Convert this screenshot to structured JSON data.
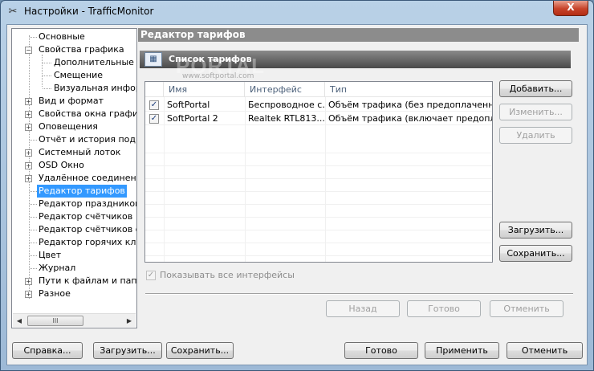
{
  "window": {
    "title": "Настройки - TrafficMonitor",
    "close_label": "X"
  },
  "tree": {
    "items": [
      {
        "label": "Основные",
        "expander": ""
      },
      {
        "label": "Свойства графика",
        "expander": "−"
      },
      {
        "label": "Дополнительные на",
        "expander": ""
      },
      {
        "label": "Смещение",
        "expander": ""
      },
      {
        "label": "Визуальная информ",
        "expander": ""
      },
      {
        "label": "Вид и формат",
        "expander": "+"
      },
      {
        "label": "Свойства окна графика",
        "expander": "+"
      },
      {
        "label": "Оповещения",
        "expander": "+"
      },
      {
        "label": "Отчёт и история подклю",
        "expander": ""
      },
      {
        "label": "Системный лоток",
        "expander": "+"
      },
      {
        "label": "OSD Окно",
        "expander": "+"
      },
      {
        "label": "Удалённое соединение",
        "expander": "+"
      },
      {
        "label": "Редактор тарифов",
        "expander": ""
      },
      {
        "label": "Редактор праздников",
        "expander": ""
      },
      {
        "label": "Редактор счётчиков",
        "expander": ""
      },
      {
        "label": "Редактор счётчиков ост",
        "expander": ""
      },
      {
        "label": "Редактор горячих клави",
        "expander": ""
      },
      {
        "label": "Цвет",
        "expander": ""
      },
      {
        "label": "Журнал",
        "expander": ""
      },
      {
        "label": "Пути к файлам и папкам",
        "expander": "+"
      },
      {
        "label": "Разное",
        "expander": "+"
      }
    ],
    "scroll_left": "◀",
    "scroll_right": "▶",
    "scroll_grip": "III"
  },
  "panel": {
    "title": "Редактор тарифов",
    "group_title": "Список тарифов",
    "watermark": "PORTAL",
    "watermark_small": "www.softportal.com",
    "columns": [
      "Имя",
      "Интерфейс",
      "Тип"
    ],
    "rows": [
      {
        "checked": "✓",
        "name": "SoftPortal",
        "interface": "Беспроводное с...",
        "type": "Объём трафика (без предоплаченн..."
      },
      {
        "checked": "✓",
        "name": "SoftPortal 2",
        "interface": "Realtek RTL813...",
        "type": "Объём трафика (включает предопл..."
      }
    ],
    "buttons": {
      "add": "Добавить...",
      "edit": "Изменить...",
      "delete": "Удалить",
      "load": "Загрузить...",
      "save": "Сохранить..."
    },
    "show_all_interfaces": {
      "label": "Показывать все интерфейсы",
      "checked": "✓"
    },
    "nav": {
      "back": "Назад",
      "done": "Готово",
      "cancel": "Отменить"
    }
  },
  "footer": {
    "help": "Справка...",
    "load": "Загрузить...",
    "save": "Сохранить...",
    "ok": "Готово",
    "apply": "Применить",
    "cancel": "Отменить"
  }
}
